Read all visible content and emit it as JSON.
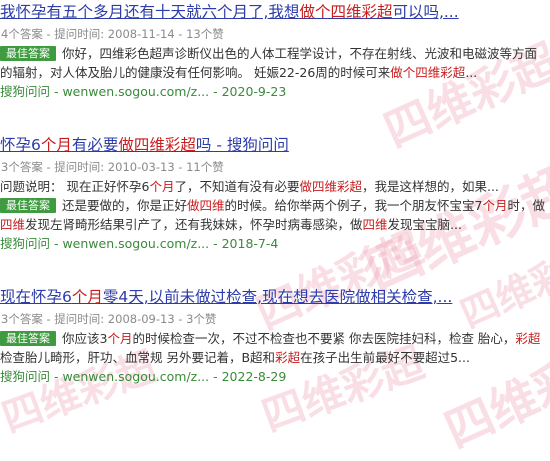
{
  "watermark": "四维彩超",
  "results": [
    {
      "title_parts": [
        "我怀孕有五个多月还有十天就六个月了,我想",
        "做个四维彩超",
        "可以吗,..."
      ],
      "meta": "4个答案 - 提问时间: 2008-11-14 - 13个赞",
      "badge": "最佳答案",
      "answer_parts": [
        "你好，四维彩色超声诊断仪出色的人体工程学设计，不存在射线、光波和电磁波等方面的辐射，对人体及胎儿的健康没有任何影响。 妊娠22-26周的时候可来",
        "做个四维彩超",
        "..."
      ],
      "source": "搜狗问问 - wenwen.sogou.com/z... - 2020-9-23"
    },
    {
      "title_parts": [
        "怀孕6",
        "个月",
        "有必要",
        "做四维彩超",
        "吗 - 搜狗问问"
      ],
      "meta": "3个答案 - 提问时间: 2010-03-13 - 11个赞",
      "question_parts": [
        "问题说明： 现在正好怀孕6",
        "个月",
        "了，不知道有没有必要",
        "做四维彩超",
        "，我是这样想的，如果..."
      ],
      "badge": "最佳答案",
      "answer_parts": [
        "还是要做的，你是正好",
        "做四维",
        "的时候。给你举两个例子，我一个朋友怀宝宝7",
        "个月",
        "时，做",
        "四维",
        "发现左肾畸形结果引产了，还有我妹妹，怀孕时病毒感染，做",
        "四维",
        "发现宝宝脑..."
      ],
      "source": "搜狗问问 - wenwen.sogou.com/z... - 2018-7-4"
    },
    {
      "title_parts": [
        "现在怀孕6",
        "个月",
        "零4天,以前未做过检查,现在想去医院做相关检查,..."
      ],
      "meta": "3个答案 - 提问时间: 2008-09-13 - 3个赞",
      "badge": "最佳答案",
      "answer_parts": [
        "你应该3",
        "个月",
        "的时候检查一次，不过不检查也不要紧 你去医院挂妇科，检查 胎心，",
        "彩超",
        "检查胎儿畸形，肝功、血常规 另外要记着，B超和",
        "彩超",
        "在孩子出生前最好不要超过5..."
      ],
      "source": "搜狗问问 - wenwen.sogou.com/z... - 2022-8-29"
    }
  ]
}
